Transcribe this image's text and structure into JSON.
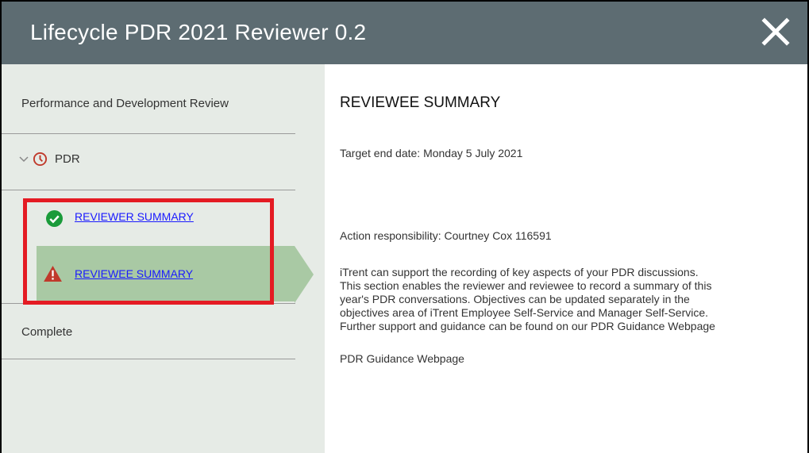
{
  "header": {
    "title": "Lifecycle PDR 2021 Reviewer 0.2",
    "close_icon": "close-icon"
  },
  "sidebar": {
    "section_title": "Performance and Development Review",
    "group": {
      "label": "PDR",
      "icon": "clock-icon",
      "expand_icon": "chevron-down-icon",
      "icon_color": "#c0392b"
    },
    "items": [
      {
        "label": "REVIEWER SUMMARY",
        "status_icon": "check-circle-icon",
        "status_color": "#1a9b3a"
      },
      {
        "label": "REVIEWEE SUMMARY",
        "status_icon": "warning-icon",
        "status_color": "#c0392b",
        "selected": true
      }
    ],
    "complete_label": "Complete"
  },
  "main": {
    "heading": "REVIEWEE SUMMARY",
    "target_end_date": "Target end date: Monday 5 July 2021",
    "action_responsibility": "Action responsibility: Courtney Cox 116591",
    "description_lines": [
      "iTrent can support the recording of key aspects of your PDR discussions.",
      "This section enables the reviewer and reviewee to record a summary of this",
      "year's PDR conversations. Objectives can be updated separately in the",
      "objectives area of iTrent Employee Self-Service and Manager Self-Service.",
      "Further support and guidance can be found on our PDR Guidance Webpage"
    ],
    "guidance_link": "PDR Guidance Webpage"
  },
  "colors": {
    "header_bg": "#5d6c72",
    "sidebar_bg": "#e6ebe6",
    "selected_bg": "#a9c9a4",
    "highlight_border": "#e41b23",
    "link": "#1a1aff"
  }
}
